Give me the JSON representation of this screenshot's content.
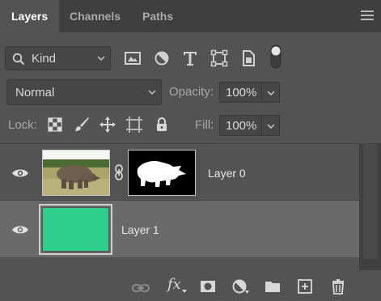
{
  "tabs": {
    "layers": "Layers",
    "channels": "Channels",
    "paths": "Paths"
  },
  "filter": {
    "kind_label": "Kind"
  },
  "blend": {
    "mode": "Normal",
    "opacity_label": "Opacity:",
    "opacity_value": "100%"
  },
  "lock": {
    "label": "Lock:",
    "fill_label": "Fill:",
    "fill_value": "100%"
  },
  "layers": [
    {
      "name": "Layer 0",
      "visible": true,
      "has_mask": true,
      "selected": false
    },
    {
      "name": "Layer 1",
      "visible": true,
      "has_mask": false,
      "selected": true,
      "fill_color": "#2ecf8c"
    }
  ],
  "bottom": {
    "fx_label": "fx"
  },
  "colors": {
    "panel_bg": "#535353",
    "tabbar_bg": "#3f3f3f",
    "selected_row": "#6a6a6a",
    "layer1_fill": "#2ecf8c"
  },
  "icons": [
    "menu-icon",
    "search-icon",
    "image-filter-icon",
    "adjustment-filter-icon",
    "type-filter-icon",
    "shape-filter-icon",
    "smart-object-filter-icon",
    "filter-toggle-icon",
    "lock-transparent-icon",
    "lock-paint-icon",
    "lock-position-icon",
    "lock-artboard-icon",
    "lock-all-icon",
    "eye-icon",
    "chain-link-icon",
    "link-layers-icon",
    "fx-icon",
    "mask-icon",
    "adjustment-layer-icon",
    "folder-icon",
    "new-layer-icon",
    "trash-icon"
  ]
}
